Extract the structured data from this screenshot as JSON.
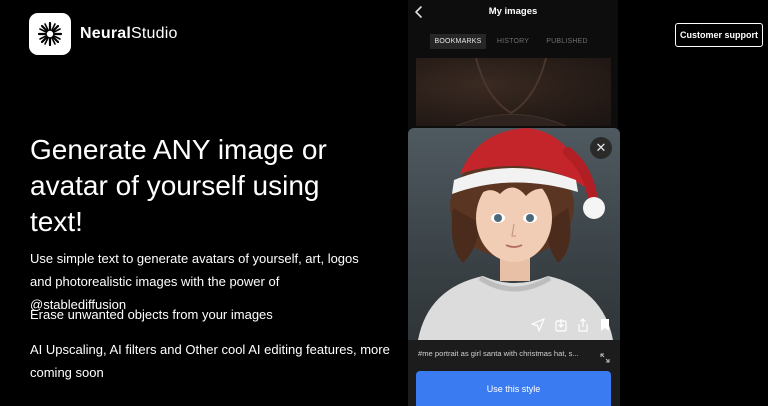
{
  "brand": {
    "name_bold": "Neural",
    "name_regular": "Studio"
  },
  "header": {
    "support_label": "Customer support"
  },
  "hero": {
    "title": "Generate ANY image or avatar of yourself using text!",
    "paragraphs": [
      "Use simple text to generate avatars of yourself, art, logos and photorealistic images with the power of @stablediffusion",
      "Erase unwanted objects from your images",
      "AI Upscaling, AI filters and Other cool AI editing features, more coming soon"
    ]
  },
  "phone": {
    "title": "My images",
    "tabs": [
      "BOOKMARKS",
      "HISTORY",
      "PUBLISHED"
    ],
    "active_tab": "BOOKMARKS",
    "prompt": "#me portrait as girl santa with christmas hat, s...",
    "use_style_label": "Use this style"
  },
  "colors": {
    "accent": "#3a7bf2",
    "background": "#000000"
  },
  "icons": [
    "snowflake-logo-icon",
    "back-chevron-icon",
    "close-icon",
    "send-icon",
    "download-icon",
    "share-icon",
    "bookmark-icon",
    "expand-icon"
  ]
}
